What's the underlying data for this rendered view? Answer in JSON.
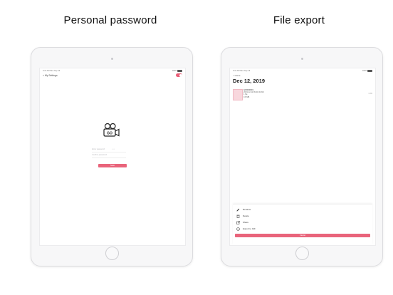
{
  "captions": {
    "left": "Personal password",
    "right": "File export"
  },
  "left_screen": {
    "status_left": "9:41 AM   Mon Sep 16",
    "status_right": "100%",
    "nav_label": "< My Settings",
    "logo_text": "GO",
    "password_placeholder": "Enter password",
    "confirm_placeholder": "Confirm password",
    "password_dots": "• • •",
    "button_label": "Save",
    "toggle_on": true,
    "accent": "#e9647b"
  },
  "right_screen": {
    "status_left": "9:41 AM   Mon Sep 16",
    "status_right": "100%",
    "back_label": "< Home",
    "date_heading": "Dec 12, 2019",
    "file": {
      "name": "GIF000001",
      "line2": "2019-12-12 09:41:00 AM",
      "line3": "1 file",
      "line4": "0.8 MB",
      "size": "0.8M"
    },
    "sheet_items": [
      {
        "label": "Rename",
        "icon": "pencil-icon"
      },
      {
        "label": "Delete",
        "icon": "trash-icon"
      },
      {
        "label": "Share",
        "icon": "share-icon"
      },
      {
        "label": "Export to GIF",
        "icon": "export-icon"
      }
    ],
    "cancel_label": "Cancel"
  }
}
